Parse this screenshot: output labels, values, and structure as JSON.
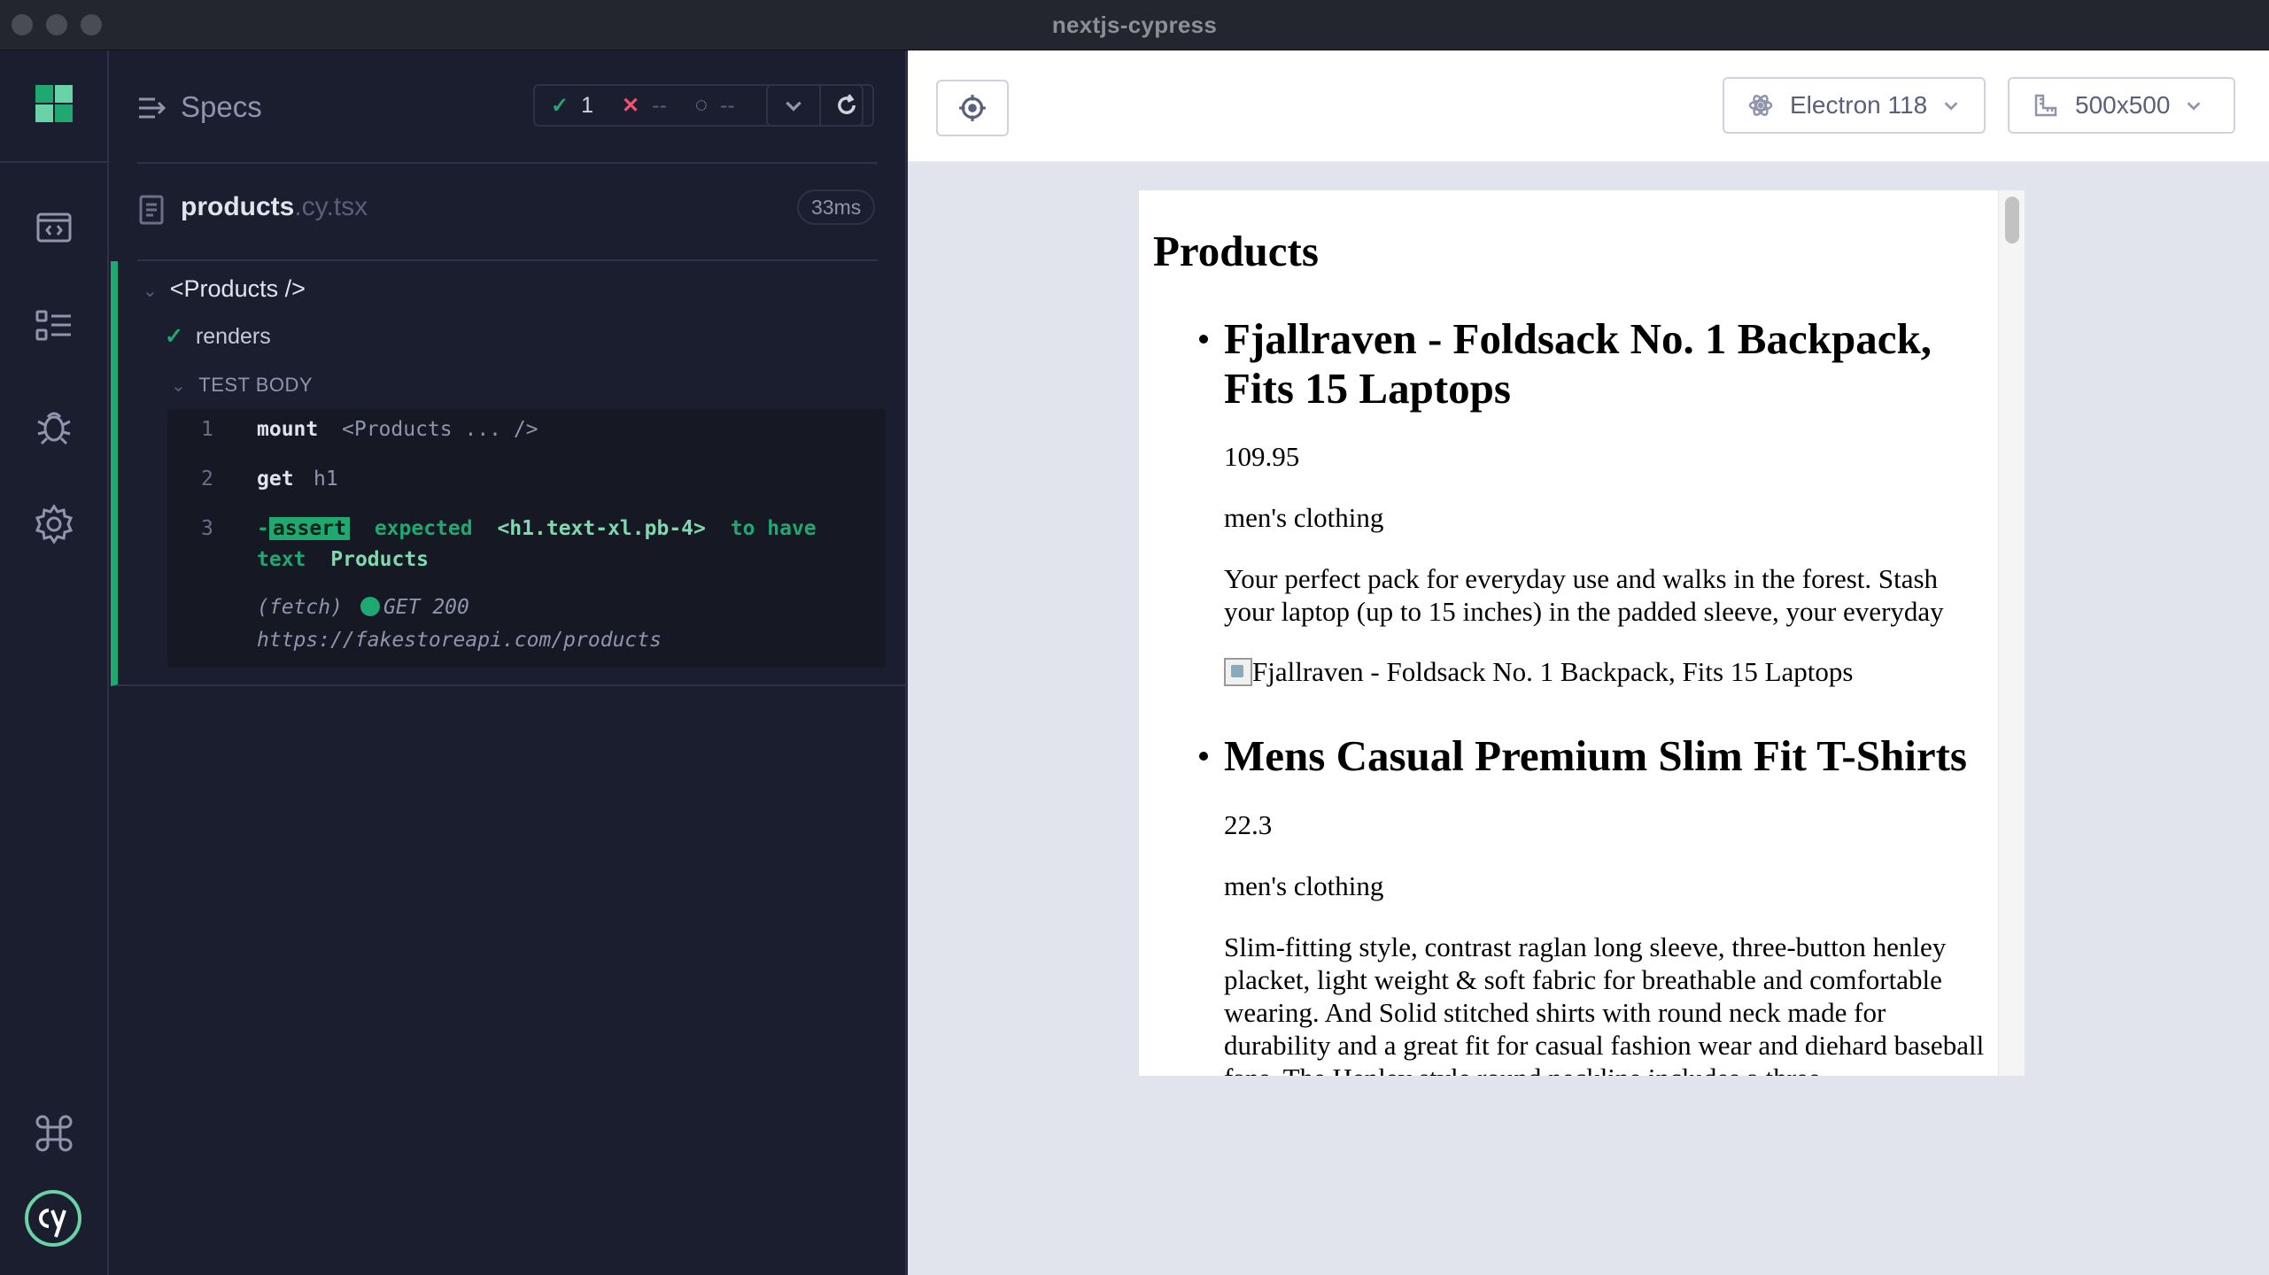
{
  "window": {
    "title": "nextjs-cypress"
  },
  "rail": {
    "icons": [
      "cypress-logo-icon",
      "runs-icon",
      "specs-list-icon",
      "debug-icon",
      "settings-icon",
      "keyboard-shortcuts-icon",
      "cy-logo-icon"
    ]
  },
  "reporter": {
    "specs_label": "Specs",
    "stats": {
      "passed": "1",
      "failed": "--",
      "pending": "--"
    },
    "spec_file": {
      "name": "products",
      "ext": ".cy.tsx",
      "duration": "33ms"
    },
    "suite": {
      "title": "<Products />",
      "test": {
        "title": "renders"
      },
      "test_body_label": "TEST BODY",
      "commands": [
        {
          "num": "1",
          "name": "mount",
          "message": "<Products ... />"
        },
        {
          "num": "2",
          "name": "get",
          "message": "h1"
        },
        {
          "num": "3",
          "name": "assert",
          "prefix": "-",
          "message_parts": [
            "expected",
            "<h1.text-xl.pb-4>",
            "to have",
            "text",
            "Products"
          ]
        }
      ],
      "fetch": {
        "label": "(fetch)",
        "status": "GET 200",
        "url": "https://fakestoreapi.com/products"
      }
    }
  },
  "aut": {
    "browser": "Electron 118",
    "viewport": "500x500",
    "page": {
      "heading": "Products",
      "products": [
        {
          "title": "Fjallraven - Foldsack No. 1 Backpack, Fits 15 Laptops",
          "price": "109.95",
          "category": "men's clothing",
          "description": "Your perfect pack for everyday use and walks in the forest. Stash your laptop (up to 15 inches) in the padded sleeve, your everyday",
          "image_alt": "Fjallraven - Foldsack No. 1 Backpack, Fits 15 Laptops"
        },
        {
          "title": "Mens Casual Premium Slim Fit T-Shirts",
          "price": "22.3",
          "category": "men's clothing",
          "description": "Slim-fitting style, contrast raglan long sleeve, three-button henley placket, light weight & soft fabric for breathable and comfortable wearing. And Solid stitched shirts with round neck made for durability and a great fit for casual fashion wear and diehard baseball fans. The Henley style round neckline includes a three"
        }
      ]
    }
  },
  "colors": {
    "pass": "#1fa971",
    "fail": "#f2526e",
    "background": "#1b1e2e",
    "aut_bg": "#e1e3ed"
  }
}
